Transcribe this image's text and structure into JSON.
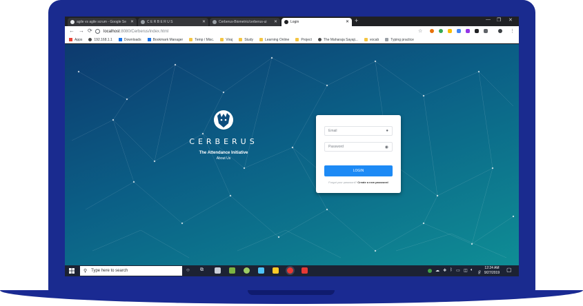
{
  "browser": {
    "tabs": [
      {
        "label": "agile vs agile scrum - Google Se",
        "active": false
      },
      {
        "label": "C E R B E R U S",
        "active": false
      },
      {
        "label": "Cerberus-Biometric/cerberus-ui",
        "active": false
      },
      {
        "label": "Login",
        "active": true
      }
    ],
    "url_host": "localhost",
    "url_path": ":8080/Cerberus/index.html",
    "bookmarks": [
      {
        "label": "Apps",
        "icon": "apps-grid-icon"
      },
      {
        "label": "192.168.1.1",
        "icon": "globe-icon"
      },
      {
        "label": "Downloads",
        "icon": "download-icon"
      },
      {
        "label": "Bookmark Manager",
        "icon": "star-icon"
      },
      {
        "label": "Temp / Misc.",
        "icon": "folder-icon"
      },
      {
        "label": "Viraj",
        "icon": "folder-icon"
      },
      {
        "label": "Study",
        "icon": "folder-icon"
      },
      {
        "label": "Learning Online",
        "icon": "folder-icon"
      },
      {
        "label": "Project",
        "icon": "folder-icon"
      },
      {
        "label": "The Maharaja Sayaji...",
        "icon": "github-icon"
      },
      {
        "label": "vocab",
        "icon": "folder-icon"
      },
      {
        "label": "Typing practice",
        "icon": "page-icon"
      }
    ]
  },
  "page": {
    "brand_name": "CERBERUS",
    "tagline": "The Attendance Initiative",
    "about_link": "About Us",
    "login": {
      "email_placeholder": "Email",
      "password_placeholder": "Password",
      "button_label": "LOGIN",
      "forgot_text": "Forgot your password?",
      "create_link": "Create a new password"
    }
  },
  "taskbar": {
    "search_placeholder": "Type here to search",
    "time": "12:24 AM",
    "date": "9/27/2019"
  },
  "colors": {
    "login_button": "#1d8af5",
    "laptop_frame": "#1a2b8f"
  }
}
